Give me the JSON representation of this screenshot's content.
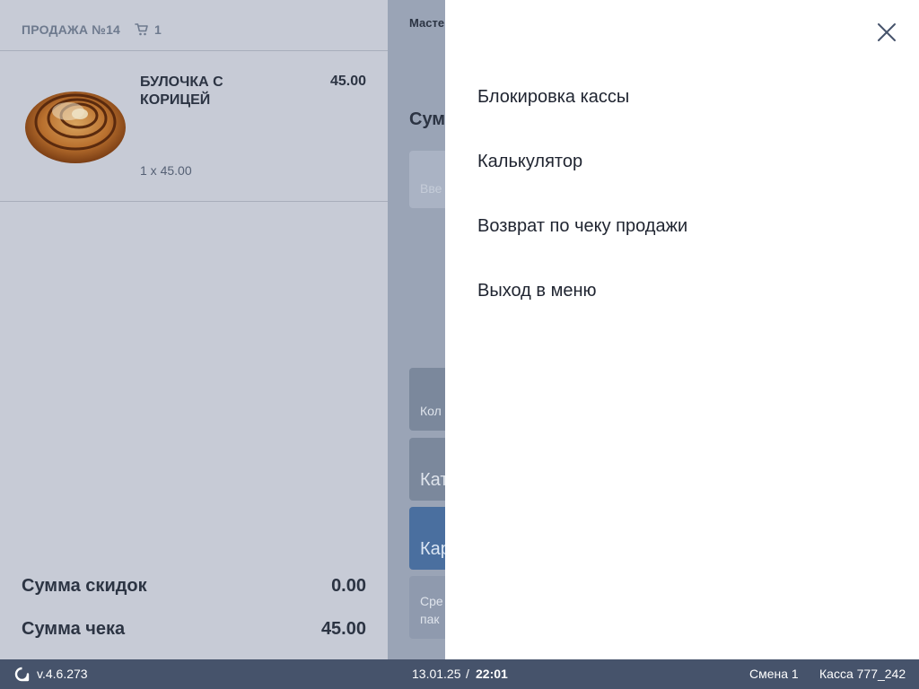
{
  "sale": {
    "title": "ПРОДАЖА №14",
    "cart_count": "1",
    "item": {
      "name": "БУЛОЧКА С КОРИЦЕЙ",
      "price": "45.00",
      "qty_line": "1 x 45.00"
    },
    "discount_label": "Сумма скидок",
    "discount_value": "0.00",
    "total_label": "Сумма чека",
    "total_value": "45.00"
  },
  "middle": {
    "header_partial": "Масте",
    "sum_partial": "Сумм",
    "input_placeholder_partial": "Вве",
    "btn_qty_partial": "Кол",
    "btn_cat_partial": "Кат",
    "btn_card_partial": "Кар",
    "btn_means_line1_partial": "Сре",
    "btn_means_line2_partial": "пак"
  },
  "menu": {
    "items": [
      {
        "label": "Блокировка кассы"
      },
      {
        "label": "Калькулятор"
      },
      {
        "label": "Возврат по чеку продажи"
      },
      {
        "label": "Выход в меню"
      }
    ],
    "close_icon": "close-icon"
  },
  "status": {
    "version": "v.4.6.273",
    "date": "13.01.25",
    "separator": "/",
    "time": "22:01",
    "shift": "Смена 1",
    "register": "Касса 777_242"
  },
  "colors": {
    "left_bg": "#c7cbd6",
    "middle_bg": "#9aa4b6",
    "card_button": "#4a6f9f",
    "statusbar": "#46536b"
  }
}
